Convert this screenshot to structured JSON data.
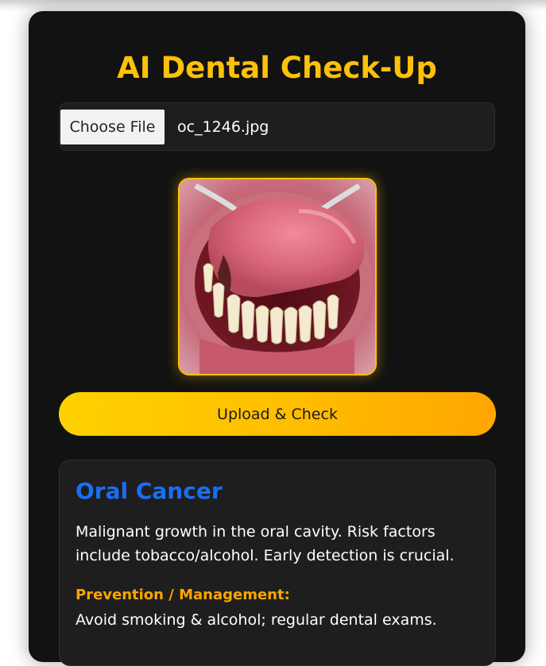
{
  "app": {
    "title": "AI Dental Check-Up"
  },
  "upload": {
    "choose_label": "Choose File",
    "file_name": "oc_1246.jpg",
    "submit_label": "Upload & Check"
  },
  "preview": {
    "subject": "mouth-photo"
  },
  "result": {
    "condition": "Oral Cancer",
    "description": "Malignant growth in the oral cavity. Risk factors include tobacco/alcohol. Early detection is crucial.",
    "prevention_label": "Prevention / Management:",
    "prevention_text": "Avoid smoking & alcohol; regular dental exams."
  },
  "colors": {
    "accent": "#ffc107",
    "card_bg": "#121212",
    "panel_bg": "#1e1e1e",
    "condition_title": "#1a6ef5",
    "prevention_label": "#ffa500"
  }
}
